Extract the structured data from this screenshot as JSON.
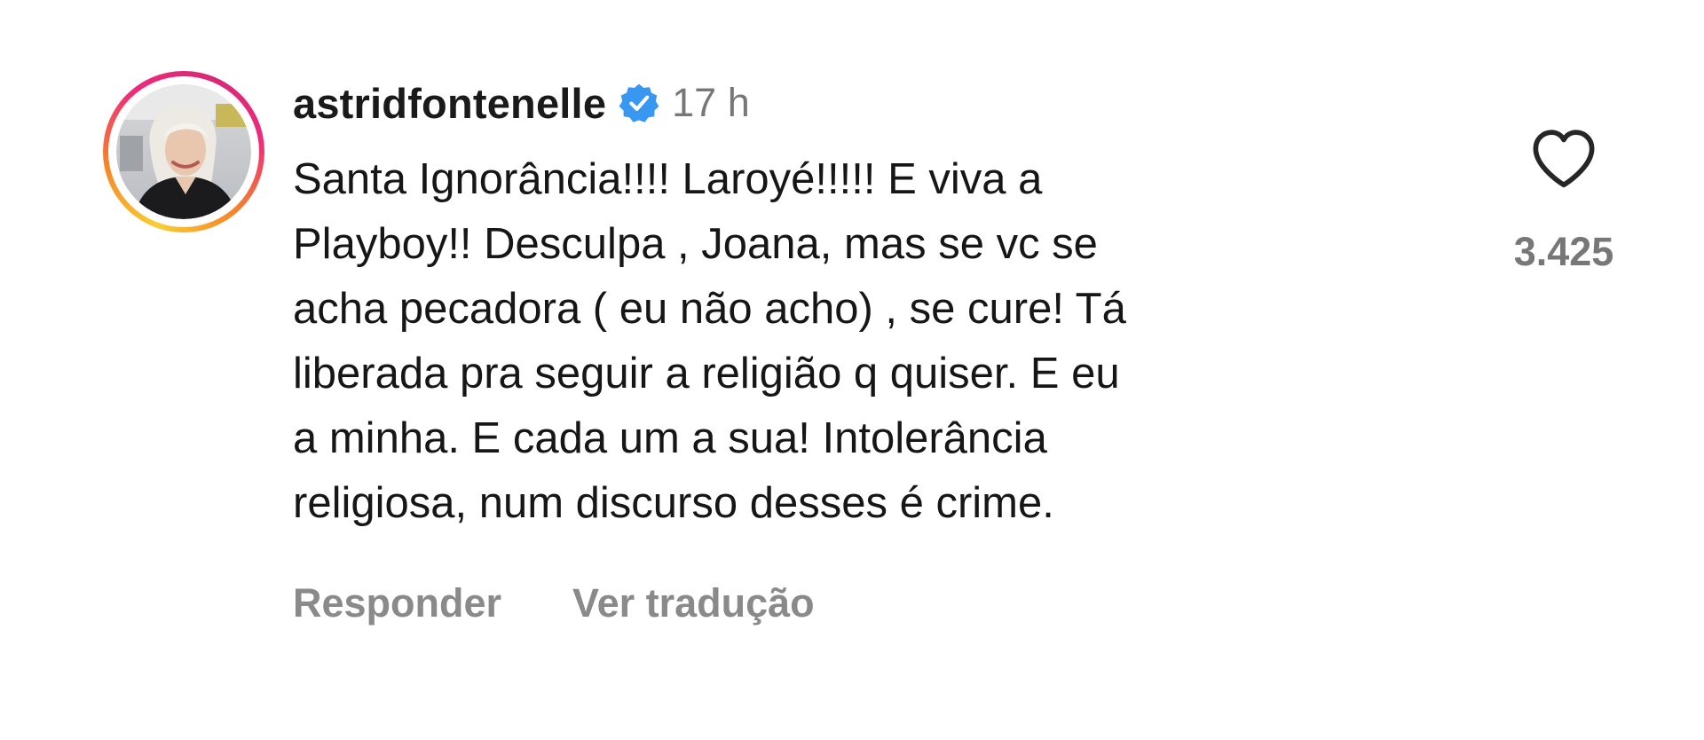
{
  "comment": {
    "username": "astridfontenelle",
    "verified_icon": "verified-badge-icon",
    "time": "17 h",
    "text": "Santa Ignorância!!!! Laroyé!!!!! E viva a\nPlayboy!! Desculpa , Joana, mas se vc se\nacha pecadora ( eu não acho) , se cure! Tá\nliberada pra seguir a religião q quiser. E eu\na minha. E cada um a sua! Intolerância\nreligiosa, num discurso desses é crime.",
    "actions": {
      "reply_label": "Responder",
      "translate_label": "Ver tradução"
    },
    "likes": {
      "icon": "heart-outline-icon",
      "count": "3.425"
    }
  },
  "colors": {
    "verified_blue": "#3897f0",
    "ring_gradient": [
      "#f9ce34",
      "#f58529",
      "#ee2a7b",
      "#d62976"
    ],
    "secondary_text": "#777777"
  }
}
